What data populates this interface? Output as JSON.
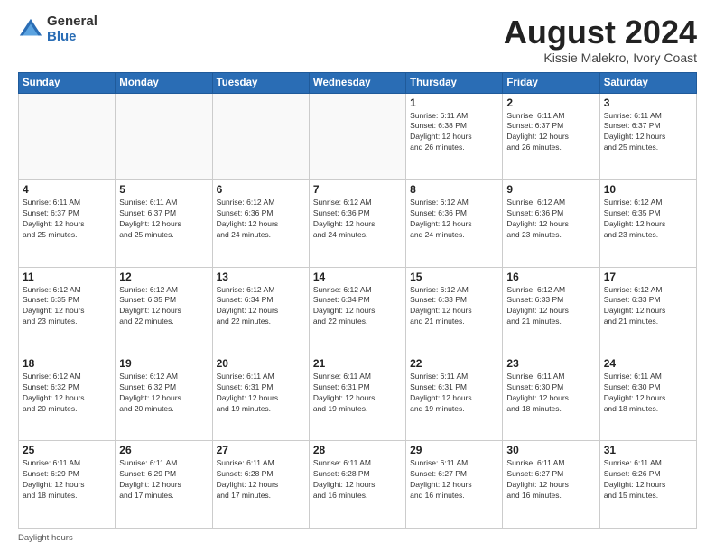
{
  "logo": {
    "general": "General",
    "blue": "Blue"
  },
  "title": "August 2024",
  "subtitle": "Kissie Malekro, Ivory Coast",
  "days_of_week": [
    "Sunday",
    "Monday",
    "Tuesday",
    "Wednesday",
    "Thursday",
    "Friday",
    "Saturday"
  ],
  "footer": "Daylight hours",
  "weeks": [
    [
      {
        "day": "",
        "info": ""
      },
      {
        "day": "",
        "info": ""
      },
      {
        "day": "",
        "info": ""
      },
      {
        "day": "",
        "info": ""
      },
      {
        "day": "1",
        "info": "Sunrise: 6:11 AM\nSunset: 6:38 PM\nDaylight: 12 hours\nand 26 minutes."
      },
      {
        "day": "2",
        "info": "Sunrise: 6:11 AM\nSunset: 6:37 PM\nDaylight: 12 hours\nand 26 minutes."
      },
      {
        "day": "3",
        "info": "Sunrise: 6:11 AM\nSunset: 6:37 PM\nDaylight: 12 hours\nand 25 minutes."
      }
    ],
    [
      {
        "day": "4",
        "info": "Sunrise: 6:11 AM\nSunset: 6:37 PM\nDaylight: 12 hours\nand 25 minutes."
      },
      {
        "day": "5",
        "info": "Sunrise: 6:11 AM\nSunset: 6:37 PM\nDaylight: 12 hours\nand 25 minutes."
      },
      {
        "day": "6",
        "info": "Sunrise: 6:12 AM\nSunset: 6:36 PM\nDaylight: 12 hours\nand 24 minutes."
      },
      {
        "day": "7",
        "info": "Sunrise: 6:12 AM\nSunset: 6:36 PM\nDaylight: 12 hours\nand 24 minutes."
      },
      {
        "day": "8",
        "info": "Sunrise: 6:12 AM\nSunset: 6:36 PM\nDaylight: 12 hours\nand 24 minutes."
      },
      {
        "day": "9",
        "info": "Sunrise: 6:12 AM\nSunset: 6:36 PM\nDaylight: 12 hours\nand 23 minutes."
      },
      {
        "day": "10",
        "info": "Sunrise: 6:12 AM\nSunset: 6:35 PM\nDaylight: 12 hours\nand 23 minutes."
      }
    ],
    [
      {
        "day": "11",
        "info": "Sunrise: 6:12 AM\nSunset: 6:35 PM\nDaylight: 12 hours\nand 23 minutes."
      },
      {
        "day": "12",
        "info": "Sunrise: 6:12 AM\nSunset: 6:35 PM\nDaylight: 12 hours\nand 22 minutes."
      },
      {
        "day": "13",
        "info": "Sunrise: 6:12 AM\nSunset: 6:34 PM\nDaylight: 12 hours\nand 22 minutes."
      },
      {
        "day": "14",
        "info": "Sunrise: 6:12 AM\nSunset: 6:34 PM\nDaylight: 12 hours\nand 22 minutes."
      },
      {
        "day": "15",
        "info": "Sunrise: 6:12 AM\nSunset: 6:33 PM\nDaylight: 12 hours\nand 21 minutes."
      },
      {
        "day": "16",
        "info": "Sunrise: 6:12 AM\nSunset: 6:33 PM\nDaylight: 12 hours\nand 21 minutes."
      },
      {
        "day": "17",
        "info": "Sunrise: 6:12 AM\nSunset: 6:33 PM\nDaylight: 12 hours\nand 21 minutes."
      }
    ],
    [
      {
        "day": "18",
        "info": "Sunrise: 6:12 AM\nSunset: 6:32 PM\nDaylight: 12 hours\nand 20 minutes."
      },
      {
        "day": "19",
        "info": "Sunrise: 6:12 AM\nSunset: 6:32 PM\nDaylight: 12 hours\nand 20 minutes."
      },
      {
        "day": "20",
        "info": "Sunrise: 6:11 AM\nSunset: 6:31 PM\nDaylight: 12 hours\nand 19 minutes."
      },
      {
        "day": "21",
        "info": "Sunrise: 6:11 AM\nSunset: 6:31 PM\nDaylight: 12 hours\nand 19 minutes."
      },
      {
        "day": "22",
        "info": "Sunrise: 6:11 AM\nSunset: 6:31 PM\nDaylight: 12 hours\nand 19 minutes."
      },
      {
        "day": "23",
        "info": "Sunrise: 6:11 AM\nSunset: 6:30 PM\nDaylight: 12 hours\nand 18 minutes."
      },
      {
        "day": "24",
        "info": "Sunrise: 6:11 AM\nSunset: 6:30 PM\nDaylight: 12 hours\nand 18 minutes."
      }
    ],
    [
      {
        "day": "25",
        "info": "Sunrise: 6:11 AM\nSunset: 6:29 PM\nDaylight: 12 hours\nand 18 minutes."
      },
      {
        "day": "26",
        "info": "Sunrise: 6:11 AM\nSunset: 6:29 PM\nDaylight: 12 hours\nand 17 minutes."
      },
      {
        "day": "27",
        "info": "Sunrise: 6:11 AM\nSunset: 6:28 PM\nDaylight: 12 hours\nand 17 minutes."
      },
      {
        "day": "28",
        "info": "Sunrise: 6:11 AM\nSunset: 6:28 PM\nDaylight: 12 hours\nand 16 minutes."
      },
      {
        "day": "29",
        "info": "Sunrise: 6:11 AM\nSunset: 6:27 PM\nDaylight: 12 hours\nand 16 minutes."
      },
      {
        "day": "30",
        "info": "Sunrise: 6:11 AM\nSunset: 6:27 PM\nDaylight: 12 hours\nand 16 minutes."
      },
      {
        "day": "31",
        "info": "Sunrise: 6:11 AM\nSunset: 6:26 PM\nDaylight: 12 hours\nand 15 minutes."
      }
    ]
  ]
}
